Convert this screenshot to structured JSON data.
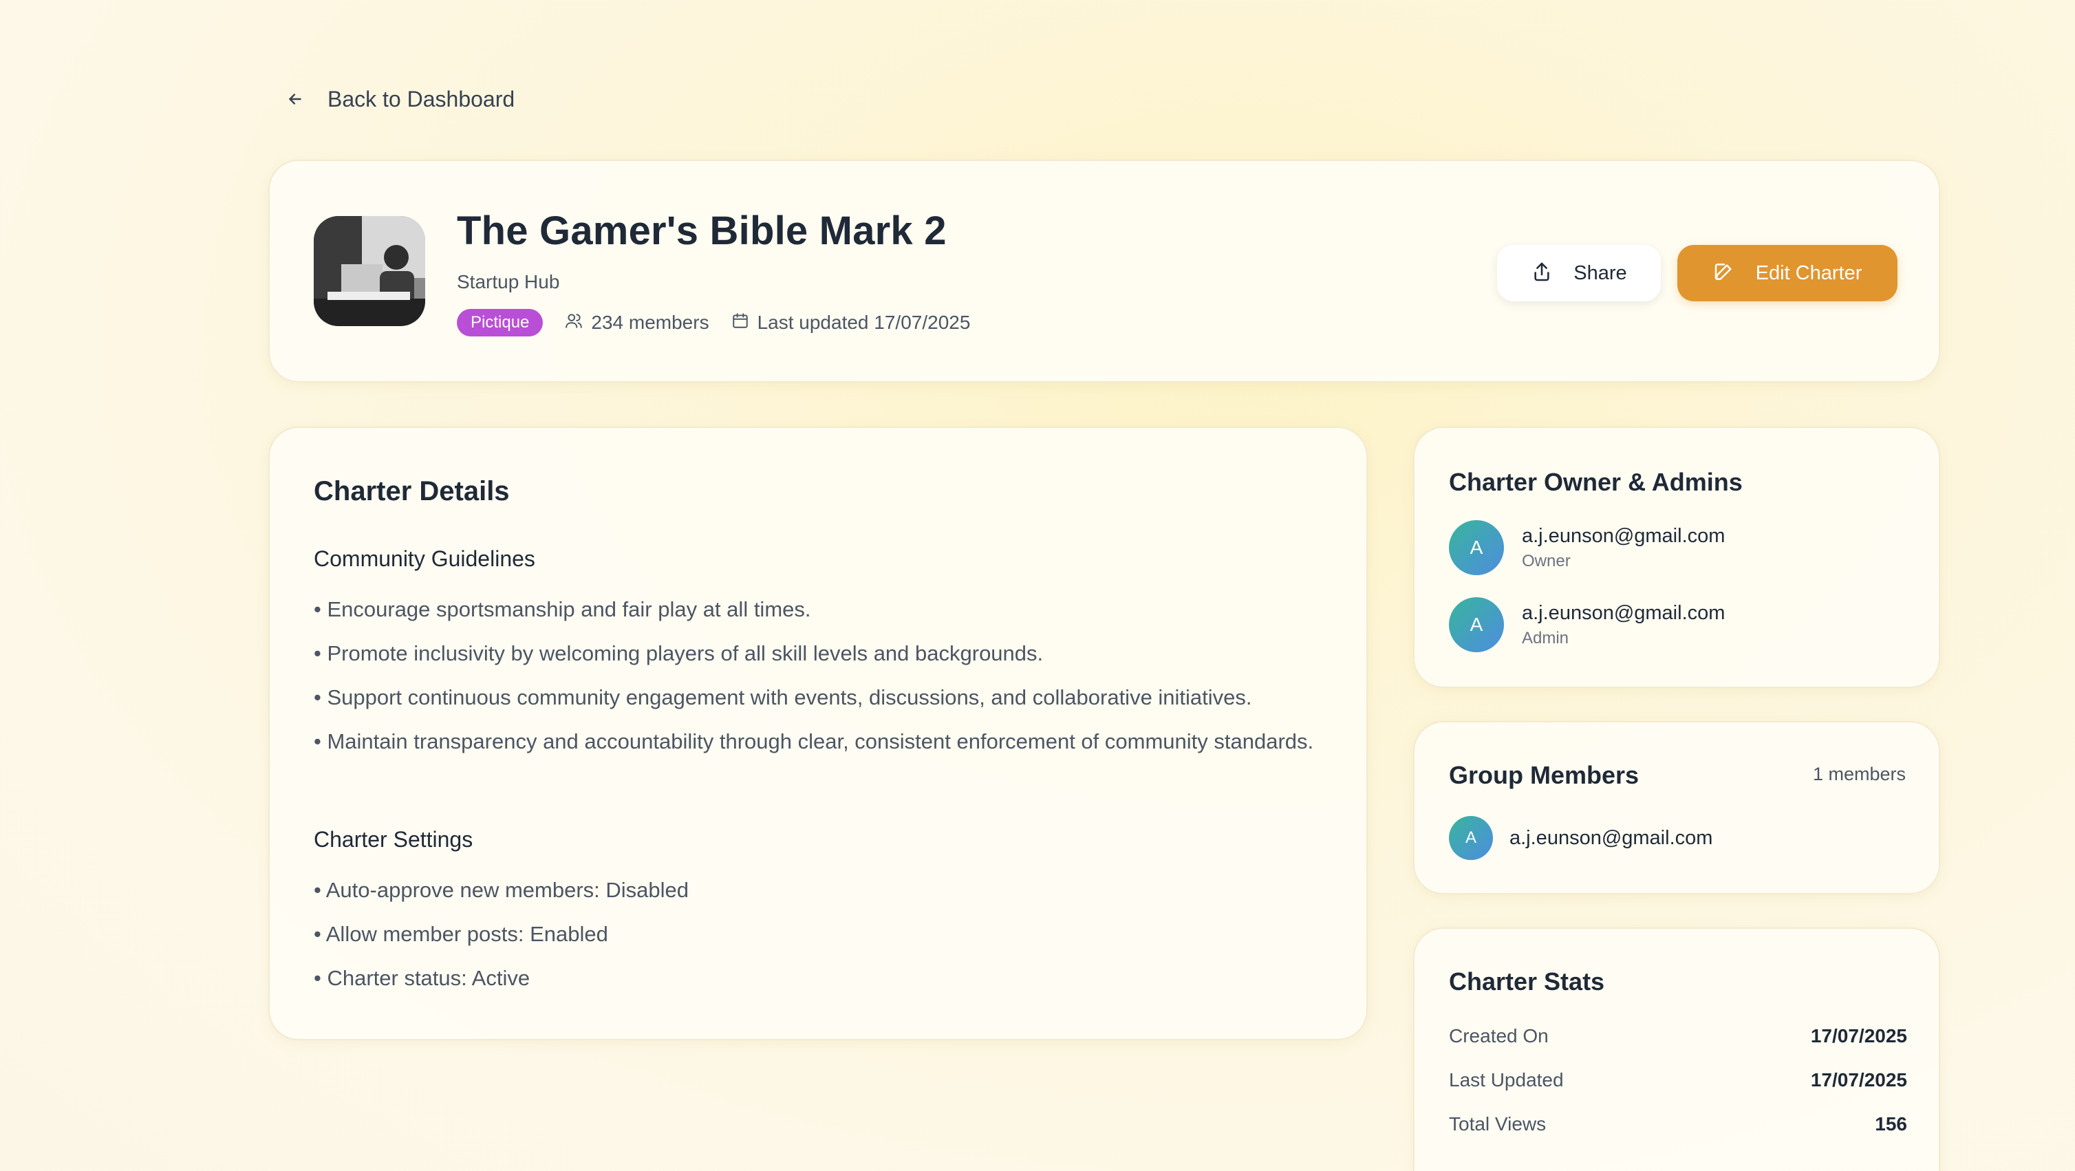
{
  "nav": {
    "back_label": "Back to Dashboard"
  },
  "charter": {
    "title": "The Gamer's Bible Mark 2",
    "subtitle": "Startup Hub",
    "tag": "Pictique",
    "members": "234 members",
    "last_updated": "Last updated 17/07/2025"
  },
  "actions": {
    "share_label": "Share",
    "edit_label": "Edit Charter"
  },
  "details": {
    "heading": "Charter Details",
    "guidelines_heading": "Community Guidelines",
    "guidelines": [
      "• Encourage sportsmanship and fair play at all times.",
      "• Promote inclusivity by welcoming players of all skill levels and backgrounds.",
      "• Support continuous community engagement with events, discussions, and collaborative initiatives.",
      "• Maintain transparency and accountability through clear, consistent enforcement of community standards."
    ],
    "settings_heading": "Charter Settings",
    "settings": [
      "• Auto-approve new members: Disabled",
      "• Allow member posts: Enabled",
      "• Charter status: Active"
    ]
  },
  "admins": {
    "heading": "Charter Owner & Admins",
    "people": [
      {
        "initial": "A",
        "email": "a.j.eunson@gmail.com",
        "role": "Owner"
      },
      {
        "initial": "A",
        "email": "a.j.eunson@gmail.com",
        "role": "Admin"
      }
    ]
  },
  "group_members": {
    "heading": "Group Members",
    "count": "1 members",
    "people": [
      {
        "initial": "A",
        "email": "a.j.eunson@gmail.com"
      }
    ]
  },
  "stats": {
    "heading": "Charter Stats",
    "rows": [
      {
        "label": "Created On",
        "value": "17/07/2025"
      },
      {
        "label": "Last Updated",
        "value": "17/07/2025"
      },
      {
        "label": "Total Views",
        "value": "156"
      }
    ]
  },
  "colors": {
    "accent": "#e0952f",
    "tag": "#b94fd6",
    "avatar_from": "#38b59b",
    "avatar_to": "#4e8de0"
  },
  "icons": {
    "back": "arrow-left-icon",
    "members": "users-icon",
    "calendar": "calendar-icon",
    "share": "share-icon",
    "edit": "edit-icon"
  }
}
